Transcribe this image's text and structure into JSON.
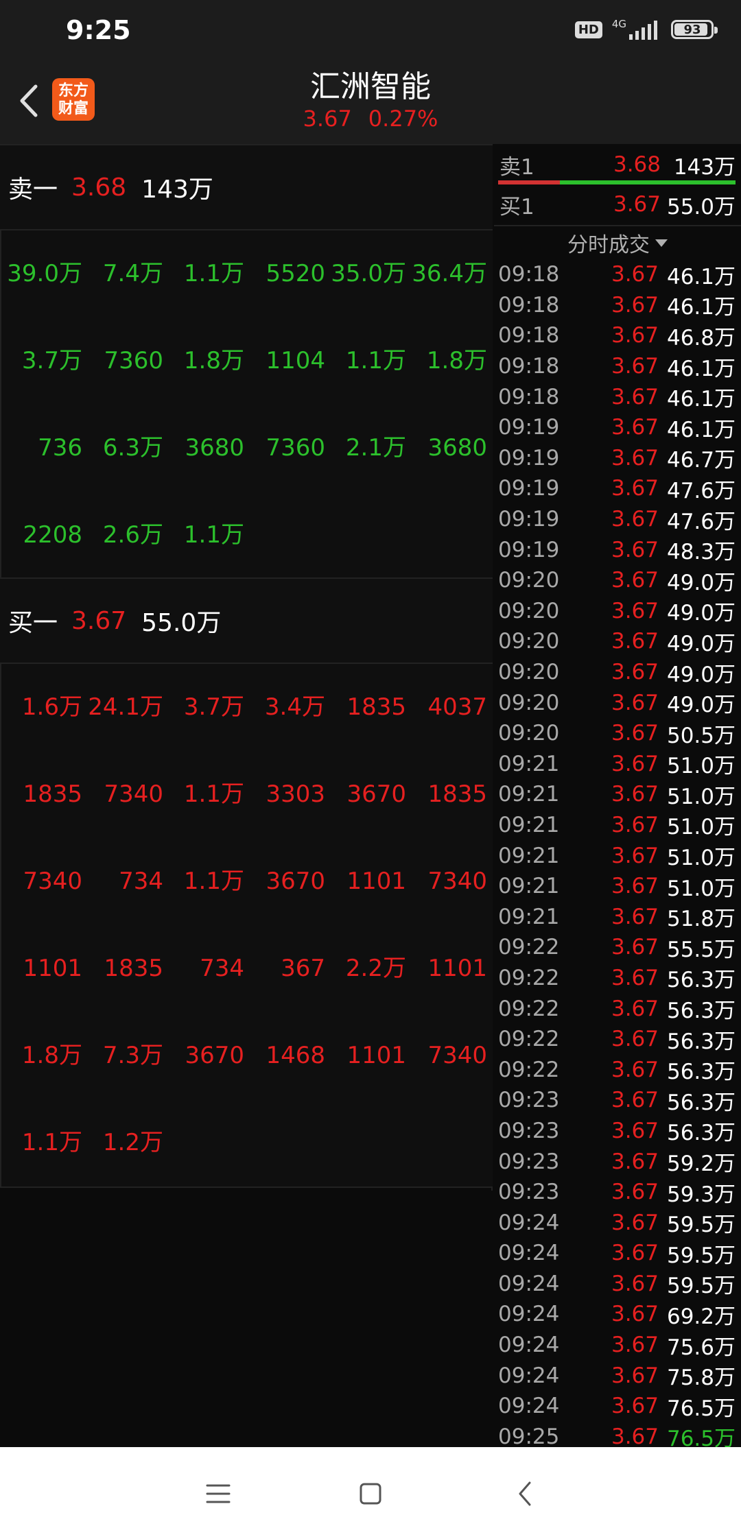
{
  "status_bar": {
    "time": "9:25",
    "hd": "HD",
    "network": "4G",
    "battery": "93",
    "battery_level": 0.93
  },
  "header": {
    "logo_line1": "东方",
    "logo_line2": "财富",
    "stock_name": "汇洲智能",
    "price": "3.67",
    "change_pct": "0.27%"
  },
  "sell_level": {
    "label": "卖一",
    "price": "3.68",
    "volume": "143万"
  },
  "sell_queue": [
    "39.0万",
    "7.4万",
    "1.1万",
    "5520",
    "35.0万",
    "36.4万",
    "3.7万",
    "7360",
    "1.8万",
    "1104",
    "1.1万",
    "1.8万",
    "736",
    "6.3万",
    "3680",
    "7360",
    "2.1万",
    "3680",
    "2208",
    "2.6万",
    "1.1万"
  ],
  "buy_level": {
    "label": "买一",
    "price": "3.67",
    "volume": "55.0万"
  },
  "buy_queue": [
    "1.6万",
    "24.1万",
    "3.7万",
    "3.4万",
    "1835",
    "4037",
    "1835",
    "7340",
    "1.1万",
    "3303",
    "3670",
    "1835",
    "7340",
    "734",
    "1.1万",
    "3670",
    "1101",
    "7340",
    "1101",
    "1835",
    "734",
    "367",
    "2.2万",
    "1101",
    "1.8万",
    "7.3万",
    "3670",
    "1468",
    "1101",
    "7340",
    "1.1万",
    "1.2万"
  ],
  "right_quote": {
    "sell1": {
      "label": "卖1",
      "price": "3.68",
      "volume": "143万"
    },
    "buy1": {
      "label": "买1",
      "price": "3.67",
      "volume": "55.0万"
    },
    "buy_ratio": 0.26
  },
  "ticks_header": "分时成交",
  "ticks": [
    {
      "time": "09:18",
      "price": "3.67",
      "volume": "46.1万"
    },
    {
      "time": "09:18",
      "price": "3.67",
      "volume": "46.1万"
    },
    {
      "time": "09:18",
      "price": "3.67",
      "volume": "46.8万"
    },
    {
      "time": "09:18",
      "price": "3.67",
      "volume": "46.1万"
    },
    {
      "time": "09:18",
      "price": "3.67",
      "volume": "46.1万"
    },
    {
      "time": "09:19",
      "price": "3.67",
      "volume": "46.1万"
    },
    {
      "time": "09:19",
      "price": "3.67",
      "volume": "46.7万"
    },
    {
      "time": "09:19",
      "price": "3.67",
      "volume": "47.6万"
    },
    {
      "time": "09:19",
      "price": "3.67",
      "volume": "47.6万"
    },
    {
      "time": "09:19",
      "price": "3.67",
      "volume": "48.3万"
    },
    {
      "time": "09:20",
      "price": "3.67",
      "volume": "49.0万"
    },
    {
      "time": "09:20",
      "price": "3.67",
      "volume": "49.0万"
    },
    {
      "time": "09:20",
      "price": "3.67",
      "volume": "49.0万"
    },
    {
      "time": "09:20",
      "price": "3.67",
      "volume": "49.0万"
    },
    {
      "time": "09:20",
      "price": "3.67",
      "volume": "49.0万"
    },
    {
      "time": "09:20",
      "price": "3.67",
      "volume": "50.5万"
    },
    {
      "time": "09:21",
      "price": "3.67",
      "volume": "51.0万"
    },
    {
      "time": "09:21",
      "price": "3.67",
      "volume": "51.0万"
    },
    {
      "time": "09:21",
      "price": "3.67",
      "volume": "51.0万"
    },
    {
      "time": "09:21",
      "price": "3.67",
      "volume": "51.0万"
    },
    {
      "time": "09:21",
      "price": "3.67",
      "volume": "51.0万"
    },
    {
      "time": "09:21",
      "price": "3.67",
      "volume": "51.8万"
    },
    {
      "time": "09:22",
      "price": "3.67",
      "volume": "55.5万"
    },
    {
      "time": "09:22",
      "price": "3.67",
      "volume": "56.3万"
    },
    {
      "time": "09:22",
      "price": "3.67",
      "volume": "56.3万"
    },
    {
      "time": "09:22",
      "price": "3.67",
      "volume": "56.3万"
    },
    {
      "time": "09:22",
      "price": "3.67",
      "volume": "56.3万"
    },
    {
      "time": "09:23",
      "price": "3.67",
      "volume": "56.3万"
    },
    {
      "time": "09:23",
      "price": "3.67",
      "volume": "56.3万"
    },
    {
      "time": "09:23",
      "price": "3.67",
      "volume": "59.2万"
    },
    {
      "time": "09:23",
      "price": "3.67",
      "volume": "59.3万"
    },
    {
      "time": "09:24",
      "price": "3.67",
      "volume": "59.5万"
    },
    {
      "time": "09:24",
      "price": "3.67",
      "volume": "59.5万"
    },
    {
      "time": "09:24",
      "price": "3.67",
      "volume": "59.5万"
    },
    {
      "time": "09:24",
      "price": "3.67",
      "volume": "69.2万"
    },
    {
      "time": "09:24",
      "price": "3.67",
      "volume": "75.6万"
    },
    {
      "time": "09:24",
      "price": "3.67",
      "volume": "75.8万"
    },
    {
      "time": "09:24",
      "price": "3.67",
      "volume": "76.5万"
    },
    {
      "time": "09:25",
      "price": "3.67",
      "volume": "76.5万",
      "highlight": true
    }
  ],
  "colors": {
    "up_red": "#e62020",
    "down_green": "#2cc02c",
    "background": "#0b0b0b",
    "header_bg": "#1c1c1c",
    "logo_orange": "#f25a1a"
  },
  "navbar": {
    "icons": [
      "menu-icon",
      "home-square-icon",
      "back-chevron-icon"
    ]
  }
}
